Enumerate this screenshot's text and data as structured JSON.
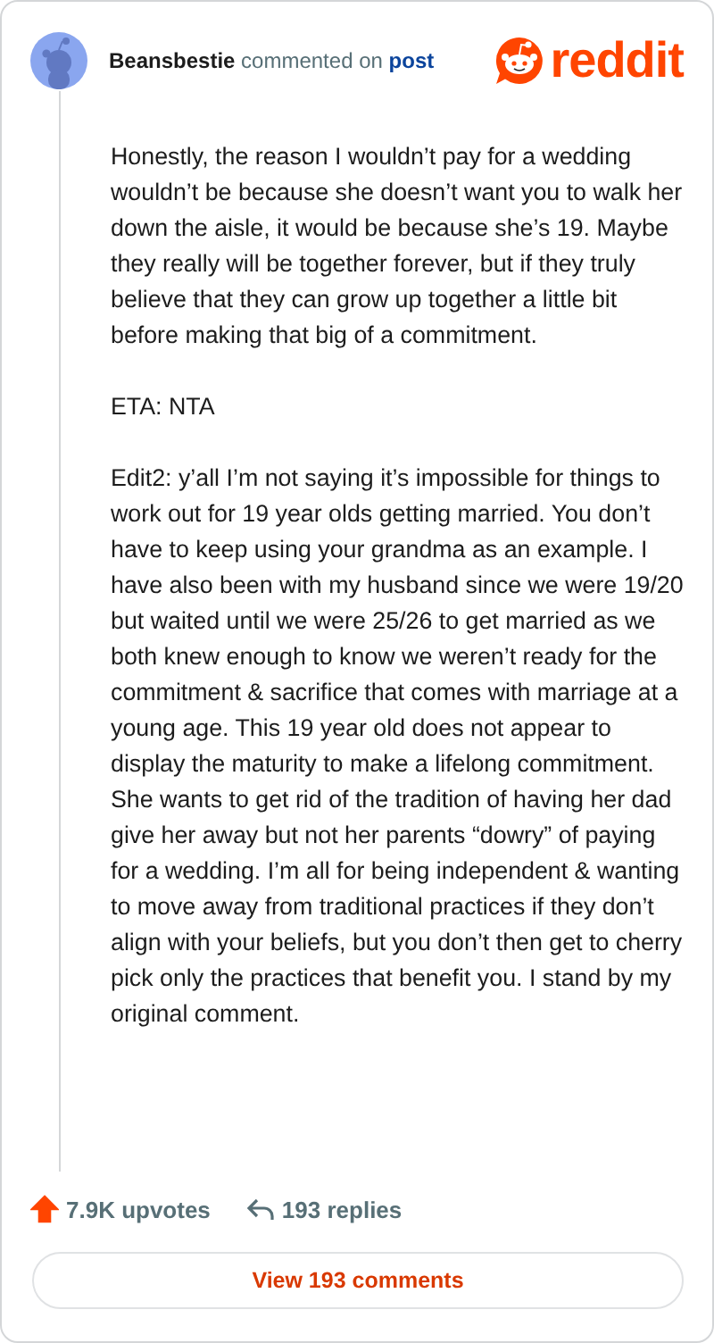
{
  "header": {
    "author": "Beansbestie",
    "action": "commented on",
    "link": "post",
    "brand": "reddit"
  },
  "comment": {
    "paragraphs": [
      "Honestly, the reason I wouldn’t pay for a wedding wouldn’t be because she doesn’t want you to walk her down the aisle, it would be because she’s 19. Maybe they really will be together forever, but if they truly believe that they can grow up together a little bit before making that big of a commitment.",
      "ETA: NTA",
      "Edit2: y’all I’m not saying it’s impossible for things to work out for 19 year olds getting married. You don’t have to keep using your grandma as an example. I have also been with my husband since we were 19/20 but waited until we were 25/26 to get married as we both knew enough to know we weren’t ready for the commitment & sacrifice that comes with marriage at a young age. This 19 year old does not appear to display the maturity to make a lifelong commitment. She wants to get rid of the tradition of having her dad give her away but not her parents “dowry” of paying for a wedding. I’m all for being independent & wanting to move away from traditional practices if they don’t align with your beliefs, but you don’t then get to cherry pick only the practices that benefit you. I stand by my original comment."
    ]
  },
  "footer": {
    "upvotes": "7.9K upvotes",
    "upvoted": true,
    "replies": "193 replies",
    "button": "View 193 comments"
  }
}
